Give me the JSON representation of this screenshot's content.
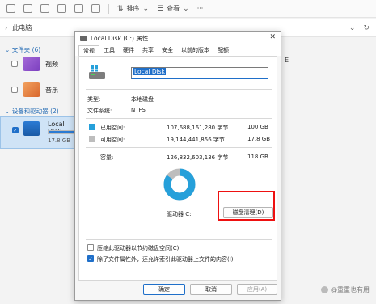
{
  "toolbar": {
    "sort_label": "排序",
    "view_label": "查看",
    "more_label": "···"
  },
  "address": {
    "path": "此电脑"
  },
  "explorer": {
    "folders_header": "文件夹 (6)",
    "items": [
      {
        "label": "视频",
        "color": "#8b4ec7"
      },
      {
        "label": "音乐",
        "color": "#e27a3c"
      }
    ],
    "devices_header": "设备和驱动器 (2)",
    "drive": {
      "label": "Local Disk",
      "free_text": "17.8 GB",
      "used_fraction": 0.85
    },
    "right_letter": "E"
  },
  "dialog": {
    "title": "Local Disk (C:) 属性",
    "tabs": [
      "常规",
      "工具",
      "硬件",
      "共享",
      "安全",
      "以前的版本",
      "配额"
    ],
    "active_tab": 0,
    "name_value": "Local Disk",
    "type_label": "类型:",
    "type_value": "本地磁盘",
    "fs_label": "文件系统:",
    "fs_value": "NTFS",
    "used_label": "已用空间:",
    "used_bytes": "107,688,161,280 字节",
    "used_gb": "100 GB",
    "free_label": "可用空间:",
    "free_bytes": "19,144,441,856 字节",
    "free_gb": "17.8 GB",
    "capacity_label": "容量:",
    "capacity_bytes": "126,832,603,136 字节",
    "capacity_gb": "118 GB",
    "used_color": "#26a0da",
    "free_color": "#bdbdbd",
    "used_fraction": 0.849,
    "drive_label": "驱动器 C:",
    "cleanup_label": "磁盘清理(D)",
    "compress_label": "压缩此驱动器以节约磁盘空间(C)",
    "index_label": "除了文件属性外，还允许索引此驱动器上文件的内容(I)",
    "ok_label": "确定",
    "cancel_label": "取消",
    "apply_label": "应用(A)"
  },
  "watermark": "@重重也有用"
}
